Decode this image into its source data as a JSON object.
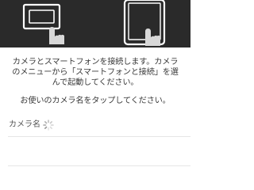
{
  "header": {
    "illustration": [
      "camera-in-hand-icon",
      "smartphone-in-hand-icon"
    ],
    "background_color": "#2a2a2a"
  },
  "instructions": {
    "text": "カメラとスマートフォンを接続します。カメラ\nのメニューから「スマートフォンと接続」を選\nんで起動してください。",
    "tap_hint": "お使いのカメラ名をタップしてください。"
  },
  "camera_list": {
    "label": "カメラ名",
    "loading_icon": "loading-spinner-icon",
    "items": []
  }
}
